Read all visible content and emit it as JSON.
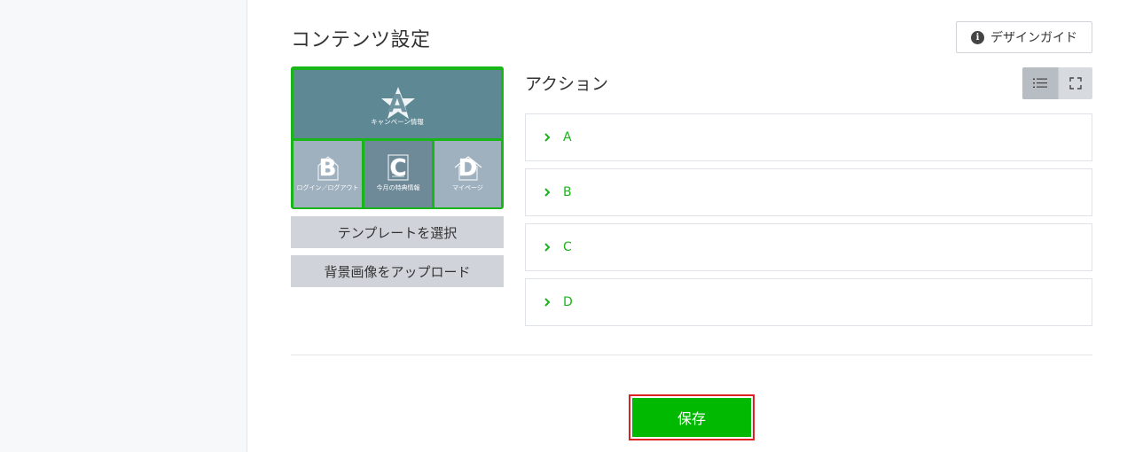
{
  "header": {
    "title": "コンテンツ設定",
    "design_guide_label": "デザインガイド",
    "info_glyph": "i"
  },
  "template": {
    "areas": [
      {
        "letter": "A",
        "caption": "キャンペーン情報",
        "icon": "star-icon"
      },
      {
        "letter": "B",
        "caption": "ログイン／ログアウト",
        "icon": "login-icon"
      },
      {
        "letter": "C",
        "caption": "今月の特典情報",
        "icon": "coupon-icon"
      },
      {
        "letter": "D",
        "caption": "マイページ",
        "icon": "home-icon"
      }
    ],
    "select_template_label": "テンプレートを選択",
    "upload_bg_label": "背景画像をアップロード"
  },
  "actions": {
    "title": "アクション",
    "view_modes": [
      "list-view",
      "fullscreen-view"
    ],
    "active_view": "list-view",
    "items": [
      {
        "label": "A"
      },
      {
        "label": "B"
      },
      {
        "label": "C"
      },
      {
        "label": "D"
      }
    ]
  },
  "footer": {
    "save_label": "保存"
  },
  "colors": {
    "accent_green": "#00b900",
    "selection_border": "#19b61a",
    "highlight_red": "#e02020",
    "area_dark": "#5f8895",
    "area_light": "#9fb1bf"
  }
}
